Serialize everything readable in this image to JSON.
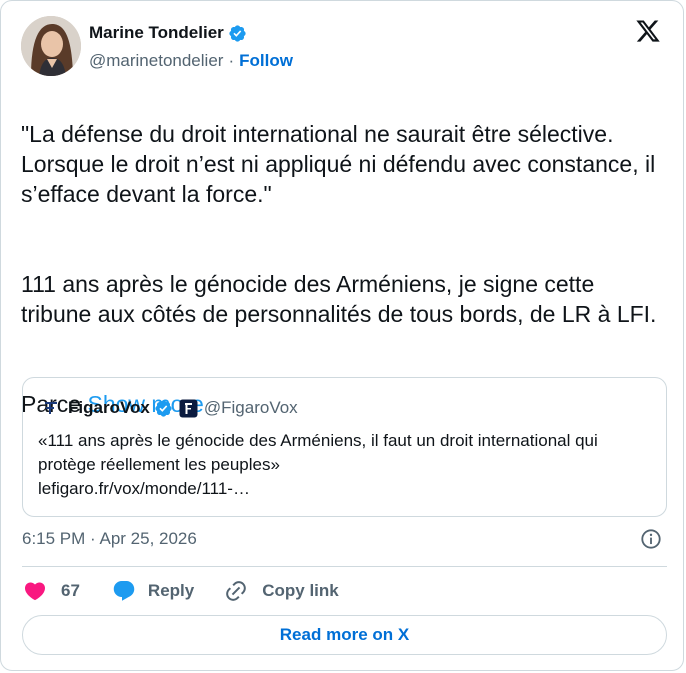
{
  "author": {
    "name": "Marine Tondelier",
    "handle": "@marinetondelier",
    "separator": "·",
    "follow_label": "Follow",
    "verified_icon": "verified-badge-icon",
    "avatar_icon": "avatar"
  },
  "brand_icon": "x-logo-icon",
  "tweet": {
    "paragraph_1": "\"La défense du droit international ne saurait être sélective. Lorsque le droit n’est ni appliqué ni défendu avec constance, il s’efface devant la force.\"",
    "paragraph_2": "111 ans après le génocide des Arméniens, je signe cette tribune aux côtés de personnalités de tous bords, de LR à LFI.",
    "paragraph_3_prefix": "Parce ",
    "show_more_label": "Show more"
  },
  "quote": {
    "name": "FigaroVox",
    "handle": "@FigaroVox",
    "text": "«111 ans après le génocide des Arméniens, il faut un droit international qui protège réellement les peuples»",
    "link": "lefigaro.fr/vox/monde/111-…"
  },
  "meta": {
    "timestamp": "6:15 PM · Apr 25, 2026"
  },
  "actions": {
    "like_count": "67",
    "reply_label": "Reply",
    "copy_link_label": "Copy link"
  },
  "read_more_label": "Read more on X",
  "colors": {
    "link_blue": "#006fd6",
    "show_more_blue": "#1d9bf0",
    "heart_red": "#f91880",
    "reply_blue": "#1d9bf0",
    "verified_blue": "#1d9bf0",
    "text_primary": "#0f1419",
    "text_secondary": "#536471",
    "border": "#cfd9de"
  }
}
